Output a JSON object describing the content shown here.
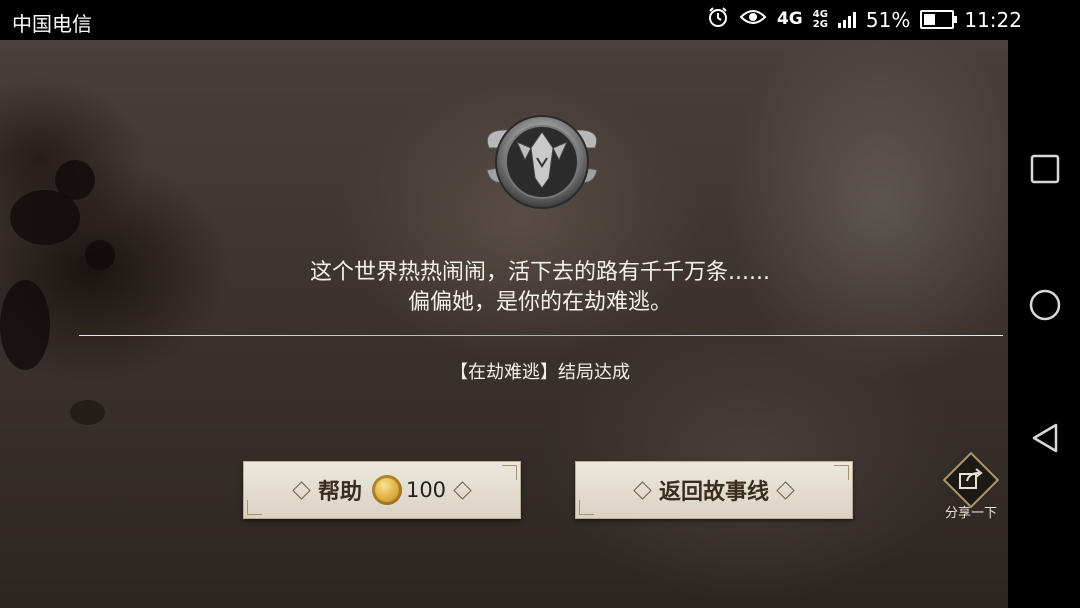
{
  "status_bar": {
    "carrier": "中国电信",
    "network_main": "4G",
    "network_small_top": "4G",
    "network_small_bottom": "2G",
    "battery_percent": "51%",
    "battery_level": 0.51,
    "time": "11:22",
    "icons": [
      "alarm-icon",
      "eye-icon",
      "signal-icon",
      "battery-icon"
    ]
  },
  "game": {
    "quote_line1": "这个世界热热闹闹，活下去的路有千千万条......",
    "quote_line2": "偏偏她，是你的在劫难逃。",
    "ending_text": "【在劫难逃】结局达成",
    "help_button": {
      "label": "帮助",
      "cost": "100"
    },
    "back_button": {
      "label": "返回故事线"
    },
    "share": {
      "label": "分享一下"
    }
  },
  "nav_bar": {
    "buttons": [
      "recent-apps-icon",
      "home-icon",
      "back-icon"
    ]
  },
  "colors": {
    "text_light": "#f3f0ea",
    "button_bg": "#e6e1d5",
    "button_text": "#3a2c1e",
    "coin_gold": "#d9a93a"
  }
}
